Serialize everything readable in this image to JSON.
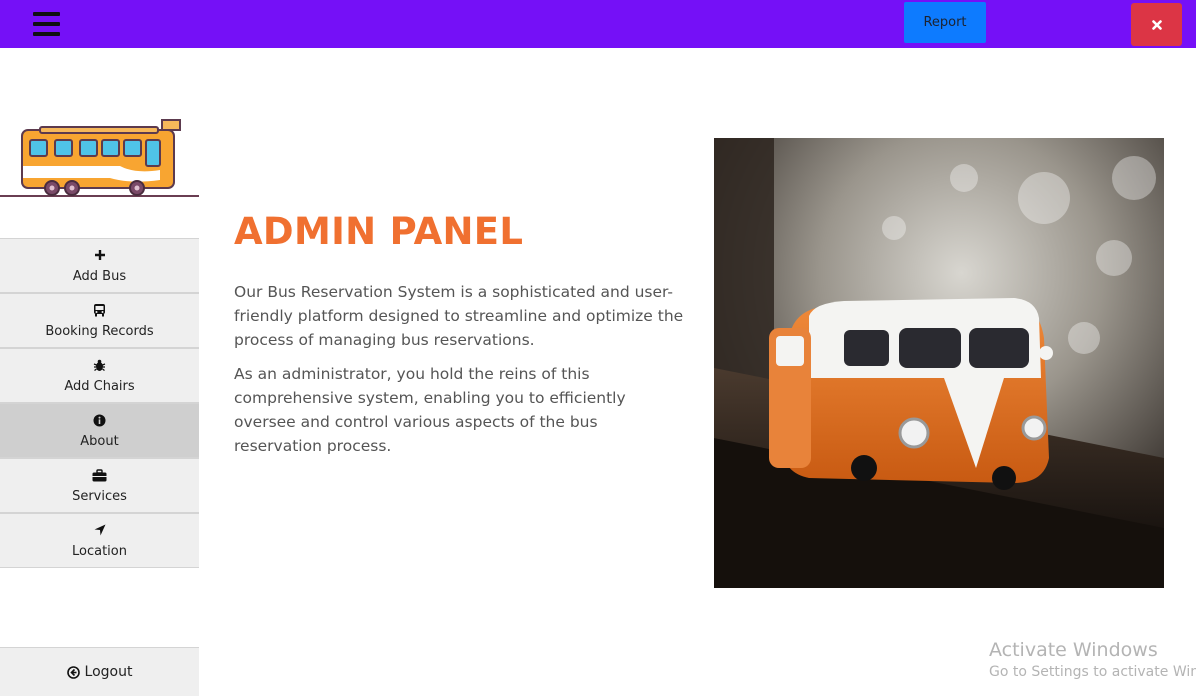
{
  "topbar": {
    "menu_icon": "hamburger-menu-icon",
    "report_label": "Report",
    "close_icon": "close-x-icon",
    "bar_color": "#7510f7",
    "report_color": "#0d7bff",
    "close_color": "#dc3545"
  },
  "sidebar": {
    "logo_icon": "bus-logo-icon",
    "items": [
      {
        "label": "Add Bus",
        "icon": "plus-icon"
      },
      {
        "label": "Booking Records",
        "icon": "bus-icon"
      },
      {
        "label": "Add Chairs",
        "icon": "bug-icon"
      },
      {
        "label": "About",
        "icon": "info-circle-icon"
      },
      {
        "label": "Services",
        "icon": "briefcase-icon"
      },
      {
        "label": "Location",
        "icon": "location-arrow-icon"
      }
    ],
    "active_item": "About",
    "logout_label": "Logout",
    "logout_icon": "arrow-circle-left-icon"
  },
  "main": {
    "title": "ADMIN PANEL",
    "title_color": "#f07030",
    "paragraph_1": "Our Bus Reservation System is a sophisticated and user-friendly platform designed to streamline and optimize the process of managing bus reservations.",
    "paragraph_2": "As an administrator, you hold the reins of this comprehensive system, enabling you to efficiently oversee and control various aspects of the bus reservation process.",
    "image_icon": "toy-van-photo"
  },
  "watermark": {
    "line1": "Activate Windows",
    "line2": "Go to Settings to activate Windows."
  }
}
